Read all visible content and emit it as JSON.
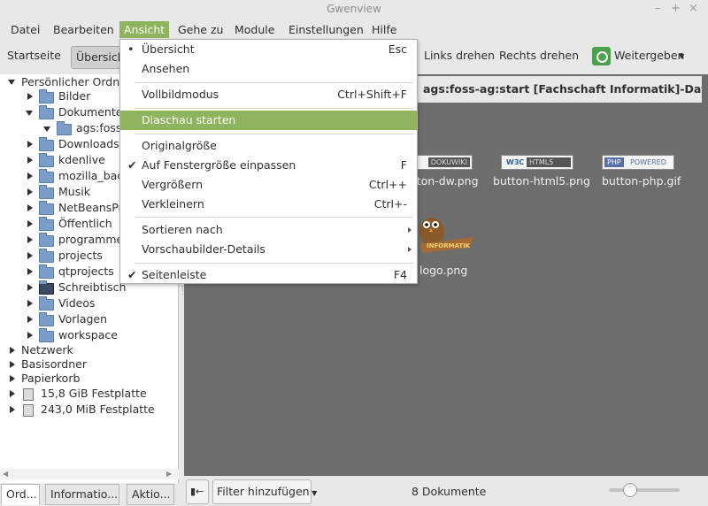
{
  "window": {
    "title": "Gwenview",
    "controls": [
      "–",
      "+",
      "×"
    ]
  },
  "menubar": [
    {
      "label": "Datei"
    },
    {
      "label": "Bearbeiten"
    },
    {
      "label": "Ansicht"
    },
    {
      "label": "Gehe zu"
    },
    {
      "label": "Module"
    },
    {
      "label": "Einstellungen"
    },
    {
      "label": "Hilfe"
    }
  ],
  "toolbar": {
    "start": "Startseite",
    "overview": "Übersicht",
    "rotate_left": "Links drehen",
    "rotate_right": "Rechts drehen",
    "share": "Weitergeben"
  },
  "sidebar": {
    "root": "Persönlicher Ordner",
    "items": [
      "Bilder",
      "Dokumente",
      "ags:foss-ag",
      "Downloads",
      "kdenlive",
      "mozilla_backup",
      "Musik",
      "NetBeansProjects",
      "Öffentlich",
      "programme",
      "projects",
      "qtprojects",
      "Schreibtisch",
      "Videos",
      "Vorlagen",
      "workspace"
    ],
    "places": [
      "Netzwerk",
      "Basisordner",
      "Papierkorb",
      "15,8 GiB Festplatte",
      "243,0 MiB Festplatte"
    ],
    "tabs": [
      "Ord...",
      "Informatio...",
      "Aktio..."
    ]
  },
  "content": {
    "path": "ags:foss-ag:start [Fachschaft Informatik]-Dateien",
    "thumbnails": [
      {
        "badge_right": "DOKUWIKI",
        "label": "button-dw.png"
      },
      {
        "badge_left": "W3C",
        "badge_right": "HTML5",
        "label": "button-html5.png"
      },
      {
        "badge_left": "PHP",
        "badge_right": "POWERED",
        "label": "button-php.gif"
      },
      {
        "badge_right": "INFORMATIK",
        "label": "logo.png"
      }
    ]
  },
  "bottombar": {
    "filter": "Filter hinzufügen",
    "count": "8 Dokumente",
    "zoom": 0.3
  },
  "menu": {
    "items": [
      {
        "label": "Übersicht",
        "shortcut": "Esc",
        "mark": "•"
      },
      {
        "label": "Ansehen",
        "shortcut": ""
      },
      {
        "label": "Vollbildmodus",
        "shortcut": "Ctrl+Shift+F"
      },
      {
        "label": "Diaschau starten",
        "shortcut": ""
      },
      {
        "label": "Originalgröße",
        "shortcut": ""
      },
      {
        "label": "Auf Fenstergröße einpassen",
        "shortcut": "F",
        "mark": "✔"
      },
      {
        "label": "Vergrößern",
        "shortcut": "Ctrl++"
      },
      {
        "label": "Verkleinern",
        "shortcut": "Ctrl+-"
      },
      {
        "label": "Sortieren nach",
        "shortcut": ""
      },
      {
        "label": "Vorschaubilder-Details",
        "shortcut": ""
      },
      {
        "label": "Seitenleiste",
        "shortcut": "F4",
        "mark": "✔"
      }
    ]
  },
  "colors": {
    "accent": "#8fb45e",
    "content_bg": "#6d6d6d",
    "folder": "#7b9ec9"
  }
}
